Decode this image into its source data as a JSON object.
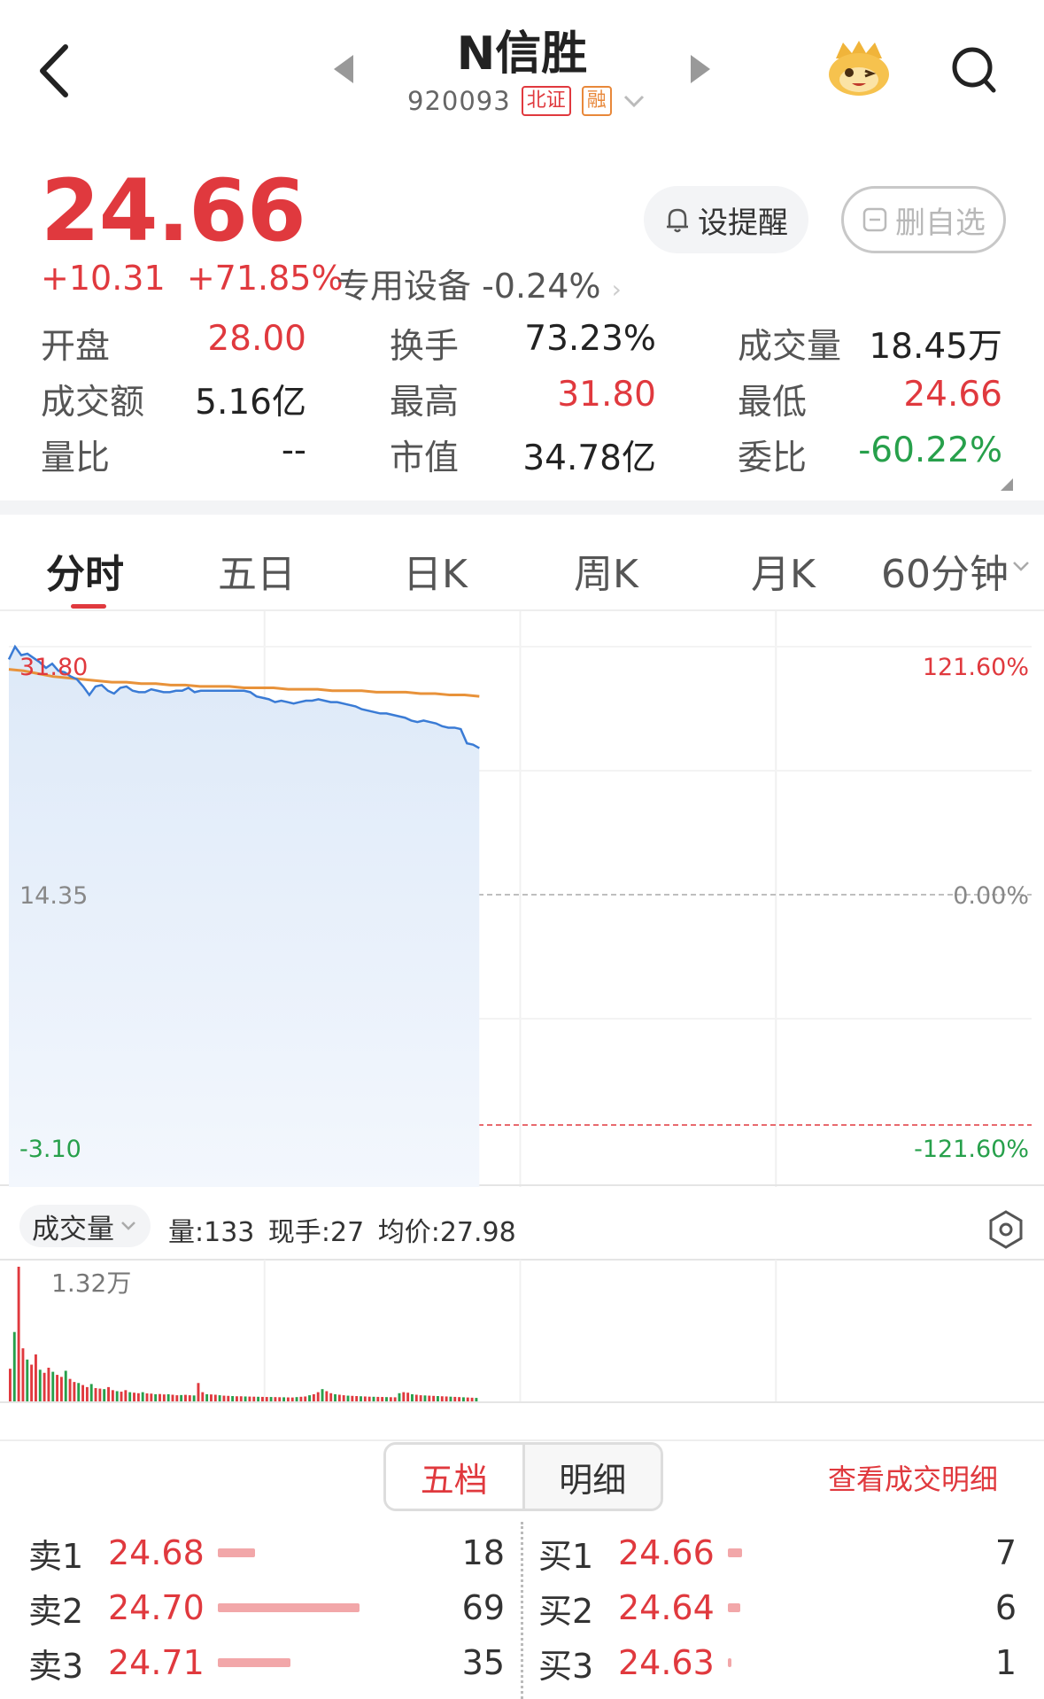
{
  "header": {
    "title": "N信胜",
    "code": "920093",
    "exchange_tag": "北证",
    "margin_tag": "融"
  },
  "quote": {
    "price": "24.66",
    "change": "+10.31",
    "change_pct": "+71.85%",
    "sector": "专用设备 -0.24%",
    "alert_label": "设提醒",
    "fav_label": "删自选"
  },
  "stats": [
    {
      "label": "开盘",
      "value": "28.00",
      "color": "red"
    },
    {
      "label": "换手",
      "value": "73.23%",
      "color": "dark"
    },
    {
      "label": "成交量",
      "value": "18.45万",
      "color": "dark"
    },
    {
      "label": "成交额",
      "value": "5.16亿",
      "color": "dark"
    },
    {
      "label": "最高",
      "value": "31.80",
      "color": "red"
    },
    {
      "label": "最低",
      "value": "24.66",
      "color": "red"
    },
    {
      "label": "量比",
      "value": "--",
      "color": "dark"
    },
    {
      "label": "市值",
      "value": "34.78亿",
      "color": "dark"
    },
    {
      "label": "委比",
      "value": "-60.22%",
      "color": "green"
    }
  ],
  "tabs": [
    "分时",
    "五日",
    "日K",
    "周K",
    "月K",
    "60分钟"
  ],
  "chart_data": {
    "type": "line",
    "price_axis": {
      "top": "31.80",
      "mid": "14.35",
      "bottom": "-3.10"
    },
    "pct_axis": {
      "top": "121.60%",
      "mid": "0.00%",
      "bottom": "-121.60%"
    },
    "ylim": [
      -3.1,
      31.8
    ],
    "sessions_total": 240,
    "price_series": [
      30.9,
      31.8,
      31.2,
      31.3,
      31.0,
      30.7,
      30.3,
      30.6,
      30.1,
      30.0,
      29.7,
      29.5,
      29.0,
      28.4,
      29.0,
      29.1,
      28.7,
      28.5,
      28.9,
      29.0,
      28.7,
      28.6,
      28.6,
      28.8,
      28.7,
      28.6,
      28.6,
      28.7,
      28.7,
      28.9,
      28.6,
      28.7,
      28.7,
      28.7,
      28.7,
      28.7,
      28.7,
      28.7,
      28.7,
      28.6,
      28.3,
      28.2,
      28.1,
      27.9,
      28.0,
      27.9,
      27.8,
      27.9,
      28.0,
      28.0,
      28.1,
      28.0,
      27.9,
      27.9,
      27.8,
      27.7,
      27.6,
      27.4,
      27.3,
      27.2,
      27.1,
      27.1,
      27.0,
      26.9,
      26.8,
      26.6,
      26.5,
      26.6,
      26.5,
      26.4,
      26.2,
      26.1,
      26.1,
      26.0,
      25.0,
      24.9,
      24.66
    ],
    "avg_series": [
      30.2,
      30.1,
      29.9,
      29.7,
      29.6,
      29.5,
      29.4,
      29.3,
      29.3,
      29.2,
      29.2,
      29.1,
      29.1,
      29.0,
      29.0,
      29.0,
      28.9,
      28.9,
      28.9,
      28.8,
      28.8,
      28.8,
      28.7,
      28.7,
      28.7,
      28.6,
      28.6,
      28.6,
      28.5,
      28.5,
      28.4,
      28.4,
      28.3
    ],
    "volume": {
      "max_label": "1.32万",
      "series": [
        3200,
        6800,
        13200,
        5200,
        4100,
        3600,
        4600,
        3100,
        2800,
        3300,
        2900,
        2600,
        2400,
        3000,
        2200,
        1900,
        1800,
        1600,
        1400,
        1700,
        1300,
        1250,
        1200,
        1400,
        1100,
        1000,
        950,
        1100,
        900,
        850,
        800,
        900,
        780,
        760,
        700,
        720,
        680,
        700,
        650,
        600,
        620,
        640,
        600,
        580,
        1800,
        900,
        700,
        680,
        650,
        600,
        560,
        540,
        520,
        500,
        500,
        480,
        470,
        460,
        450,
        440,
        430,
        430,
        420,
        410,
        400,
        390,
        380,
        420,
        450,
        480,
        600,
        700,
        900,
        1200,
        1000,
        800,
        700,
        650,
        600,
        560,
        540,
        520,
        500,
        480,
        460,
        450,
        440,
        430,
        420,
        410,
        400,
        800,
        900,
        850,
        700,
        650,
        600,
        580,
        560,
        540,
        520,
        500,
        480,
        460,
        440,
        420,
        400,
        380,
        360,
        340
      ],
      "colors": "mixed"
    }
  },
  "volume_bar": {
    "selector": "成交量",
    "info": "量:133  现手:27  均价:27.98"
  },
  "orderbook": {
    "tabs": [
      "五档",
      "明细"
    ],
    "detail_link": "查看成交明细",
    "sell": [
      {
        "label": "卖1",
        "price": "24.68",
        "qty": "18",
        "ratio": 0.26
      },
      {
        "label": "卖2",
        "price": "24.70",
        "qty": "69",
        "ratio": 1.0
      },
      {
        "label": "卖3",
        "price": "24.71",
        "qty": "35",
        "ratio": 0.51
      }
    ],
    "buy": [
      {
        "label": "买1",
        "price": "24.66",
        "qty": "7",
        "ratio": 0.1
      },
      {
        "label": "买2",
        "price": "24.64",
        "qty": "6",
        "ratio": 0.09
      },
      {
        "label": "买3",
        "price": "24.63",
        "qty": "1",
        "ratio": 0.02
      }
    ]
  },
  "colors": {
    "up": "#e0393e",
    "down": "#27a04b",
    "price_line": "#3a7bd5",
    "avg_line": "#e8923a"
  }
}
